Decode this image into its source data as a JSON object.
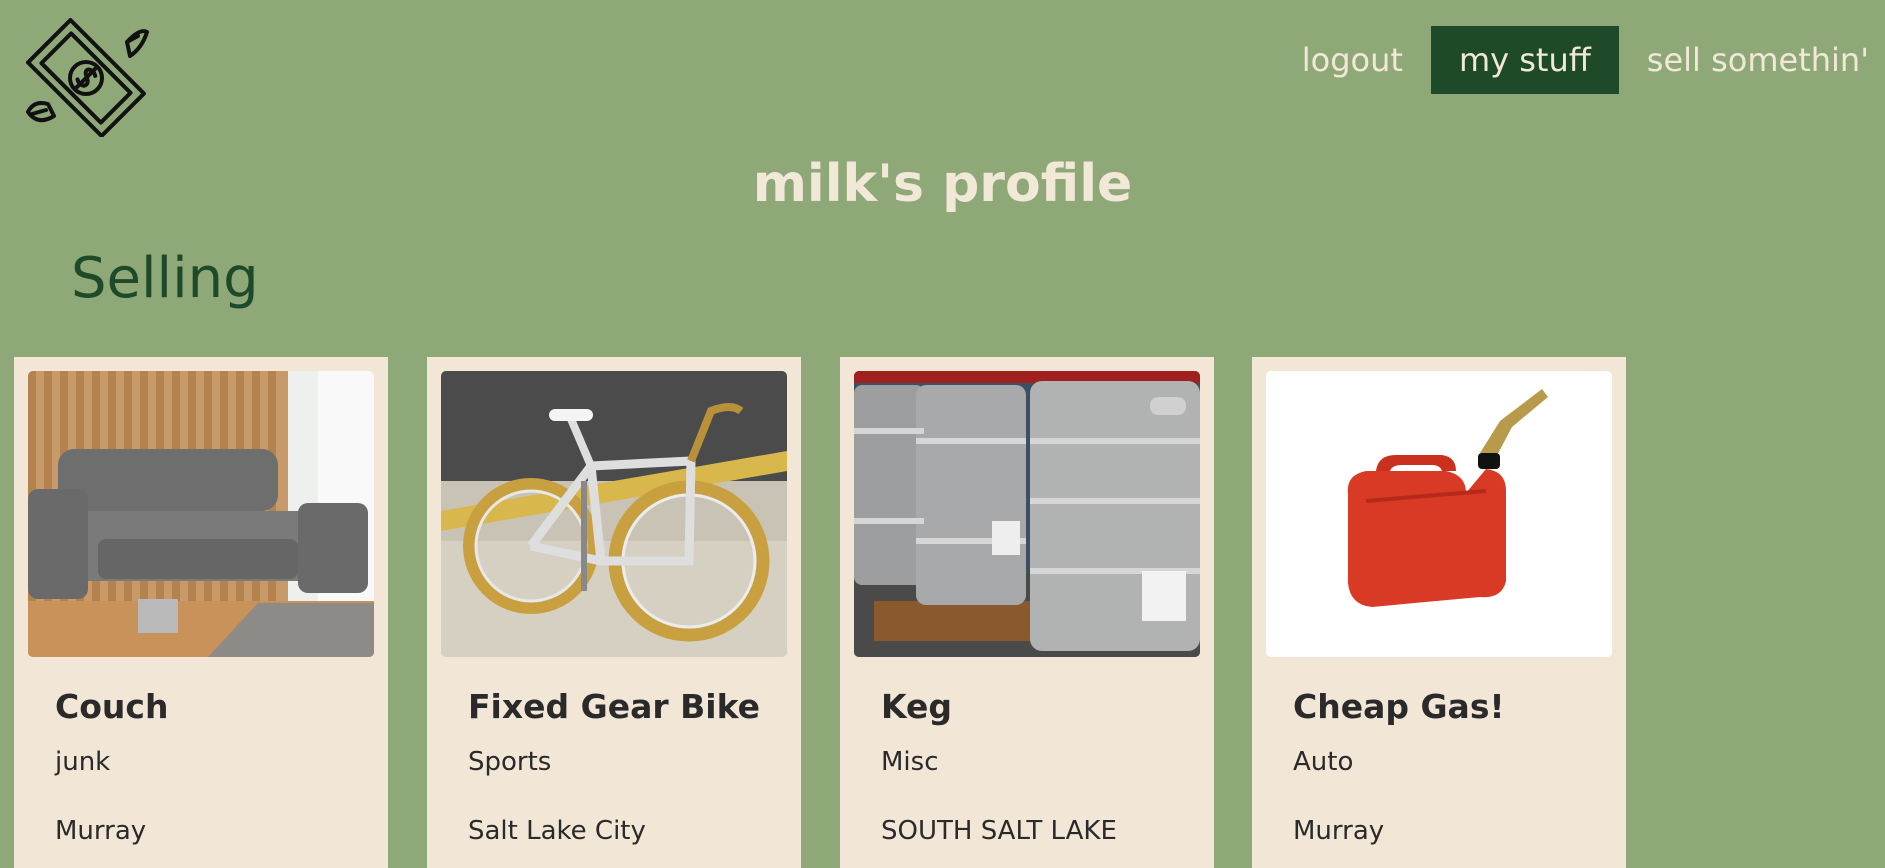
{
  "header": {
    "logo_icon": "flying-money-icon",
    "nav": [
      {
        "label": "logout"
      },
      {
        "label": "my stuff"
      },
      {
        "label": "sell somethin'"
      }
    ]
  },
  "profile": {
    "title": "milk's profile"
  },
  "selling": {
    "heading": "Selling",
    "items": [
      {
        "title": "Couch",
        "category": "junk",
        "location": "Murray",
        "image_icon": "couch-photo"
      },
      {
        "title": "Fixed Gear Bike",
        "category": "Sports",
        "location": "Salt Lake City",
        "image_icon": "bike-photo"
      },
      {
        "title": "Keg",
        "category": "Misc",
        "location": "SOUTH SALT LAKE",
        "image_icon": "keg-photo"
      },
      {
        "title": "Cheap Gas!",
        "category": "Auto",
        "location": "Murray",
        "image_icon": "gas-can-photo"
      }
    ]
  },
  "colors": {
    "background": "#8fa878",
    "nav_active": "#1f4a2a",
    "nav_text": "#f2e8d8",
    "heading": "#1f4a2a",
    "card": "#f2e6d6"
  }
}
